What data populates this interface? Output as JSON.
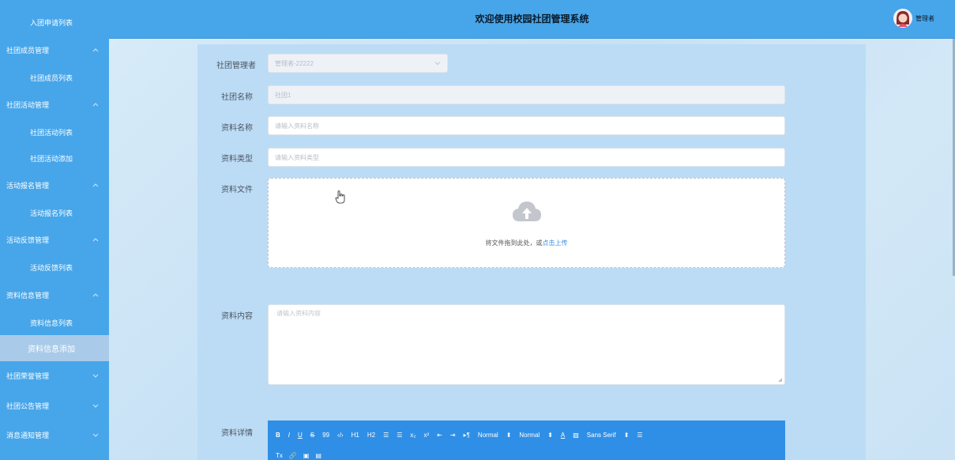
{
  "sidebar": {
    "items": [
      {
        "label": "入团申请列表",
        "type": "sub",
        "top": 0
      },
      {
        "label": "社团成员管理",
        "type": "group",
        "expanded": true
      },
      {
        "label": "社团成员列表",
        "type": "sub"
      },
      {
        "label": "社团活动管理",
        "type": "group",
        "expanded": true
      },
      {
        "label": "社团活动列表",
        "type": "sub"
      },
      {
        "label": "社团活动添加",
        "type": "sub"
      },
      {
        "label": "活动报名管理",
        "type": "group",
        "expanded": true
      },
      {
        "label": "活动报名列表",
        "type": "sub"
      },
      {
        "label": "活动反馈管理",
        "type": "group",
        "expanded": true
      },
      {
        "label": "活动反馈列表",
        "type": "sub"
      },
      {
        "label": "资料信息管理",
        "type": "group",
        "expanded": true
      },
      {
        "label": "资料信息列表",
        "type": "sub"
      },
      {
        "label": "资料信息添加",
        "type": "sub",
        "active": true
      },
      {
        "label": "社团荣誉管理",
        "type": "group",
        "expanded": false
      },
      {
        "label": "社团公告管理",
        "type": "group",
        "expanded": false
      },
      {
        "label": "消息通知管理",
        "type": "group",
        "expanded": false
      }
    ]
  },
  "header": {
    "title": "欢迎使用校园社团管理系统",
    "user_name": "管理者"
  },
  "form": {
    "manager_label": "社团管理者",
    "manager_value": "管理者-22222",
    "club_name_label": "社团名称",
    "club_name_value": "社团1",
    "material_name_label": "资料名称",
    "material_name_placeholder": "请输入资料名称",
    "material_type_label": "资料类型",
    "material_type_placeholder": "请输入资料类型",
    "material_file_label": "资料文件",
    "upload_text": "将文件拖到此处，或",
    "upload_link": "点击上传",
    "material_content_label": "资料内容",
    "material_content_placeholder": "请输入资料内容",
    "material_detail_label": "资料详情"
  },
  "editor": {
    "toolbar": [
      "B",
      "I",
      "U",
      "S",
      "99",
      "‹/›",
      "H1",
      "H2",
      "☰",
      "☰",
      "x₂",
      "x²",
      "⇤",
      "⇥",
      "▸¶",
      "Normal",
      "⬍",
      "Normal",
      "⬍",
      "A",
      "▨",
      "Sans Serif",
      "⬍",
      "☰"
    ],
    "toolbar2": [
      "Tx",
      "🔗",
      "▣",
      "▤"
    ]
  },
  "colors": {
    "sidebar_bg": "#47a6ea",
    "header_bg": "#47a6ea",
    "active_item": "#a9cbe9",
    "editor_bg": "#2f8fe6"
  }
}
